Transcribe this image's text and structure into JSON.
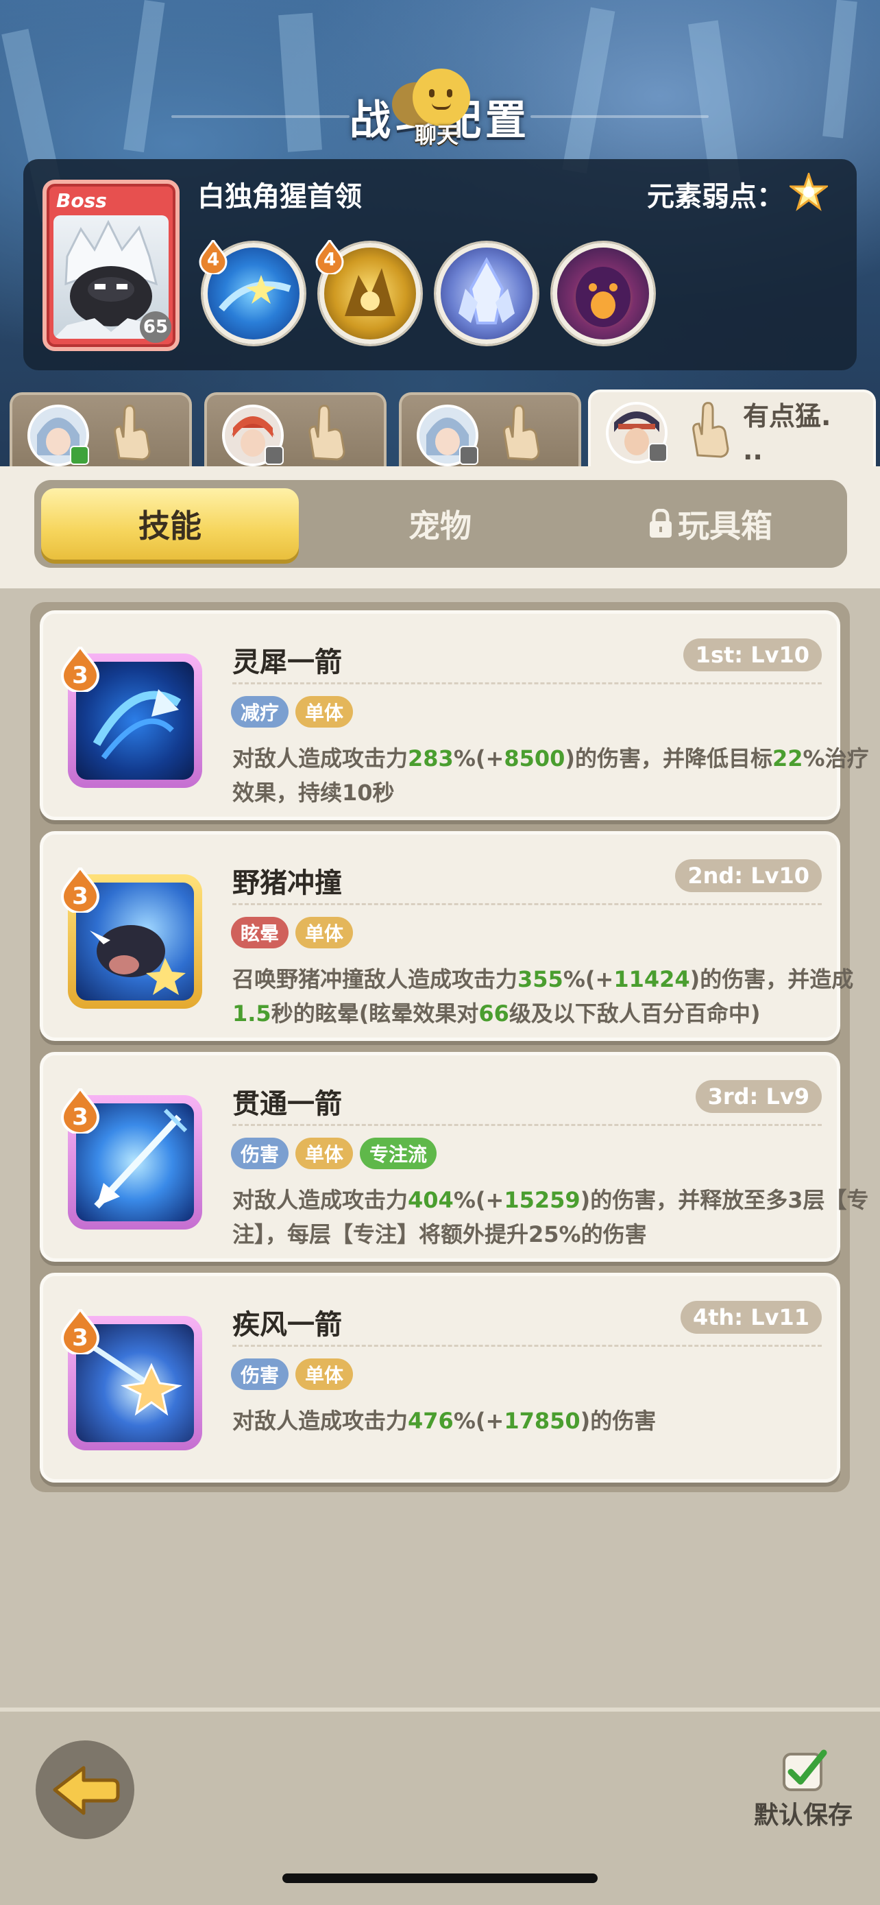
{
  "header": {
    "title": "战斗配置",
    "chat_label": "聊天"
  },
  "boss": {
    "tag": "Boss",
    "level": "65",
    "name": "白独角猩首领",
    "weakness_label": "元素弱点：",
    "weakness_icon": "light-star-icon",
    "skill_orbs": [
      {
        "icon": "swirl-star-icon",
        "badge": "4"
      },
      {
        "icon": "golden-spirit-icon",
        "badge": "4"
      },
      {
        "icon": "ice-crystal-icon"
      },
      {
        "icon": "dark-face-icon"
      }
    ]
  },
  "heroes": [
    {
      "name": "",
      "active": false,
      "badge_color": "#3fa33b"
    },
    {
      "name": "",
      "active": false,
      "badge_color": "#6b6b6b"
    },
    {
      "name": "",
      "active": false,
      "badge_color": "#6b6b6b"
    },
    {
      "name": "有点猛.\n..",
      "active": true,
      "badge_color": "#6b6b6b"
    }
  ],
  "tabs": {
    "skills": "技能",
    "pets": "宠物",
    "toybox": "玩具箱"
  },
  "skills": [
    {
      "tier": "3",
      "name": "灵犀一箭",
      "level": "1st: Lv10",
      "tags": [
        {
          "text": "减疗",
          "color": "#7b9fd0"
        },
        {
          "text": "单体",
          "color": "#e4b65a"
        }
      ],
      "desc_parts": [
        {
          "t": "对敌人造成攻击力",
          "h": false
        },
        {
          "t": "283",
          "h": true
        },
        {
          "t": "%(+",
          "h": false
        },
        {
          "t": "8500",
          "h": true
        },
        {
          "t": ")的伤害，并降低目标",
          "h": false
        },
        {
          "t": "22",
          "h": true
        },
        {
          "t": "%治疗效果，持续10秒",
          "h": false
        }
      ]
    },
    {
      "tier": "3",
      "name": "野猪冲撞",
      "level": "2nd: Lv10",
      "tags": [
        {
          "text": "眩晕",
          "color": "#d0615b"
        },
        {
          "text": "单体",
          "color": "#e4b65a"
        }
      ],
      "desc_parts": [
        {
          "t": "召唤野猪冲撞敌人造成攻击力",
          "h": false
        },
        {
          "t": "355",
          "h": true
        },
        {
          "t": "%(+",
          "h": false
        },
        {
          "t": "11424",
          "h": true
        },
        {
          "t": ")的伤害，并造成",
          "h": false
        },
        {
          "t": "1.5",
          "h": true
        },
        {
          "t": "秒的眩晕(眩晕效果对",
          "h": false
        },
        {
          "t": "66",
          "h": true
        },
        {
          "t": "级及以下敌人百分百命中)",
          "h": false
        }
      ]
    },
    {
      "tier": "3",
      "name": "贯通一箭",
      "level": "3rd: Lv9",
      "tags": [
        {
          "text": "伤害",
          "color": "#7b9fd0"
        },
        {
          "text": "单体",
          "color": "#e4b65a"
        },
        {
          "text": "专注流",
          "color": "#5fb84a"
        }
      ],
      "desc_parts": [
        {
          "t": "对敌人造成攻击力",
          "h": false
        },
        {
          "t": "404",
          "h": true
        },
        {
          "t": "%(+",
          "h": false
        },
        {
          "t": "15259",
          "h": true
        },
        {
          "t": ")的伤害，并释放至多3层【专注】，每层【专注】将额外提升25%的伤害",
          "h": false
        }
      ]
    },
    {
      "tier": "3",
      "name": "疾风一箭",
      "level": "4th: Lv11",
      "tags": [
        {
          "text": "伤害",
          "color": "#7b9fd0"
        },
        {
          "text": "单体",
          "color": "#e4b65a"
        }
      ],
      "desc_parts": [
        {
          "t": "对敌人造成攻击力",
          "h": false
        },
        {
          "t": "476",
          "h": true
        },
        {
          "t": "%(+",
          "h": false
        },
        {
          "t": "17850",
          "h": true
        },
        {
          "t": ")的伤害",
          "h": false
        }
      ]
    }
  ],
  "footer": {
    "save_label": "默认保存"
  }
}
